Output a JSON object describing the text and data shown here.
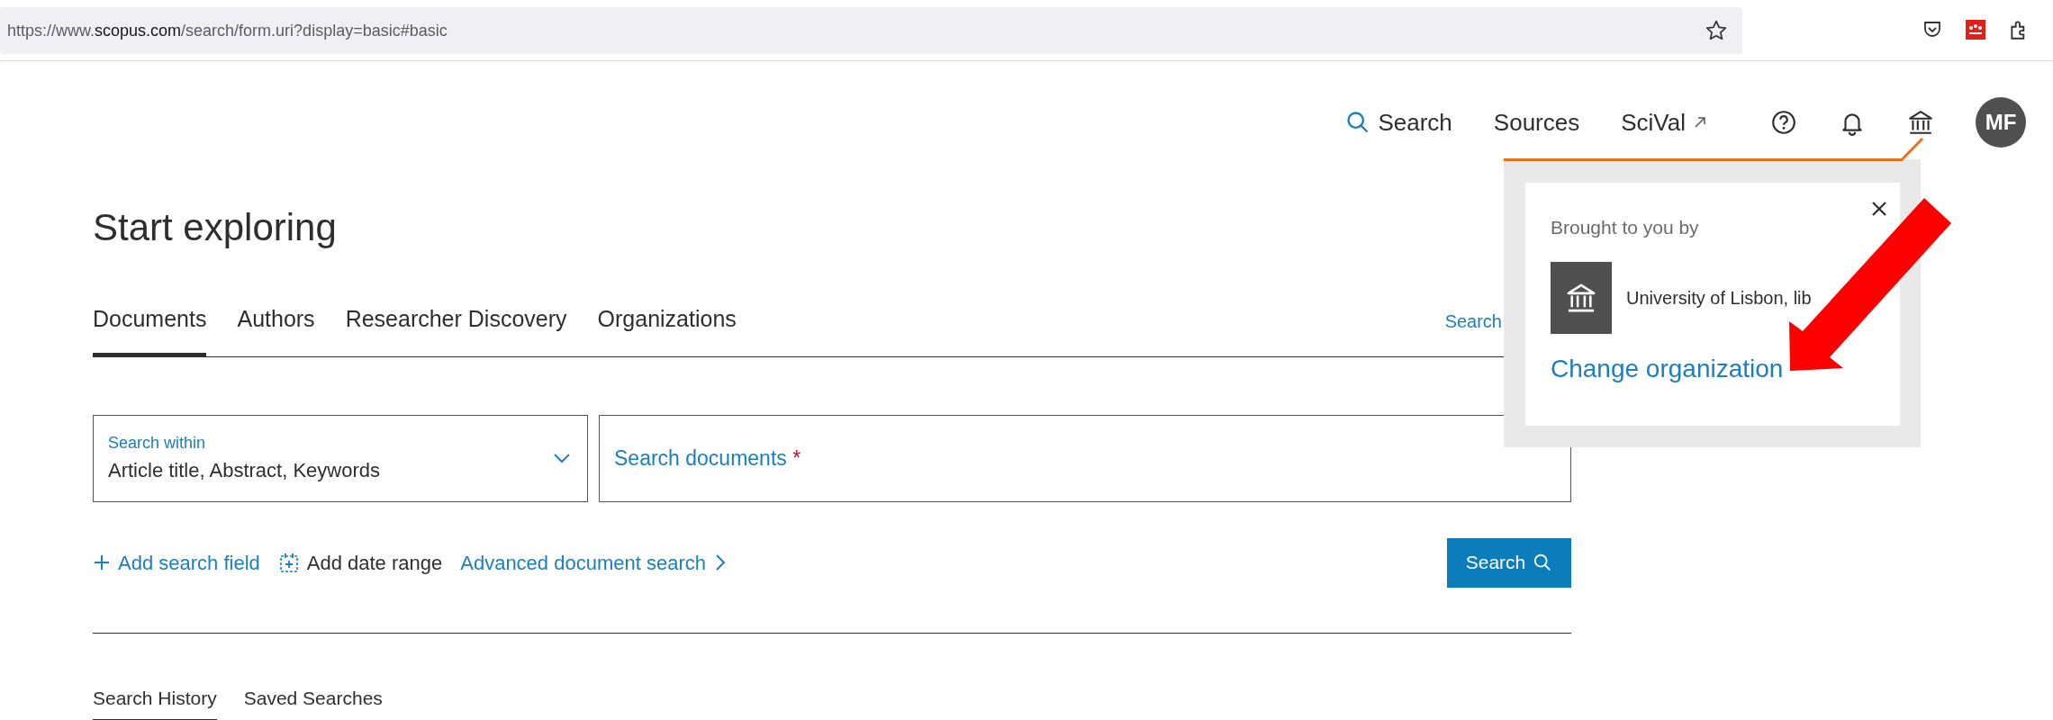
{
  "browser": {
    "url_parts": [
      {
        "kind": "muted",
        "text": "https://www."
      },
      {
        "kind": "domain",
        "text": "scopus.com"
      },
      {
        "kind": "muted",
        "text": "/search/form.uri?display=basic#basic"
      }
    ]
  },
  "nav": {
    "items": [
      {
        "kind": "search",
        "label": "Search"
      },
      {
        "kind": "link",
        "label": "Sources"
      },
      {
        "kind": "external",
        "label": "SciVal"
      }
    ],
    "icons": [
      {
        "kind": "help"
      },
      {
        "kind": "bell"
      },
      {
        "kind": "institution"
      }
    ],
    "avatar": "MF"
  },
  "popup": {
    "heading": "Brought to you by",
    "institution": "University of Lisbon, lib",
    "link": "Change organization"
  },
  "page_title": "Start exploring",
  "tabs": [
    {
      "label": "Documents",
      "selected": true
    },
    {
      "label": "Authors",
      "selected": false
    },
    {
      "label": "Researcher Discovery",
      "selected": false
    },
    {
      "label": "Organizations",
      "selected": false
    }
  ],
  "tabs_link": "Search",
  "search_within": {
    "label": "Search within",
    "value": "Article title, Abstract, Keywords"
  },
  "search_field": {
    "placeholder": "Search documents",
    "required_mark": "*"
  },
  "actions": [
    {
      "kind": "add",
      "label": "Add search field"
    },
    {
      "kind": "date",
      "label": "Add date range"
    },
    {
      "kind": "advanced",
      "label": "Advanced document search"
    }
  ],
  "search_button": "Search",
  "history_tabs": [
    {
      "label": "Search History",
      "selected": true
    },
    {
      "label": "Saved Searches",
      "selected": false
    }
  ]
}
